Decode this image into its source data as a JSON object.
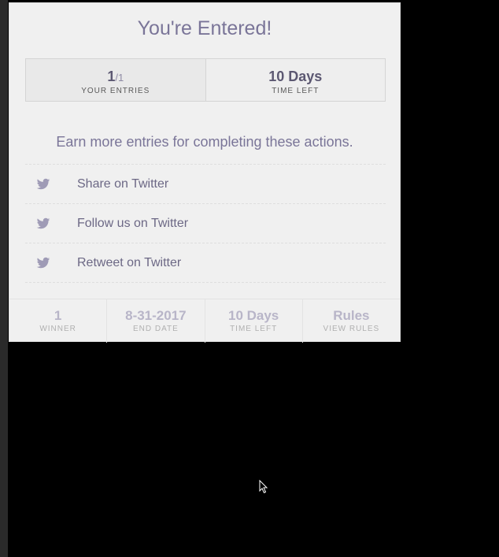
{
  "widget": {
    "title": "You're Entered!",
    "entries": {
      "value": "1",
      "total": "/1",
      "label": "YOUR ENTRIES"
    },
    "time_left": {
      "value": "10 Days",
      "label": "TIME LEFT"
    },
    "earn_text": "Earn more entries for completing these actions.",
    "actions": [
      {
        "icon": "twitter-bird-icon",
        "label": "Share on Twitter"
      },
      {
        "icon": "twitter-bird-icon",
        "label": "Follow us on Twitter"
      },
      {
        "icon": "twitter-bird-icon",
        "label": "Retweet on Twitter"
      }
    ],
    "footer": [
      {
        "value": "1",
        "label": "WINNER"
      },
      {
        "value": "8-31-2017",
        "label": "END DATE"
      },
      {
        "value": "10 Days",
        "label": "TIME LEFT"
      },
      {
        "value": "Rules",
        "label": "VIEW RULES"
      }
    ]
  },
  "colors": {
    "accent": "#7a7598",
    "panel_bg": "#f0f0f0",
    "page_bg": "#000000"
  }
}
